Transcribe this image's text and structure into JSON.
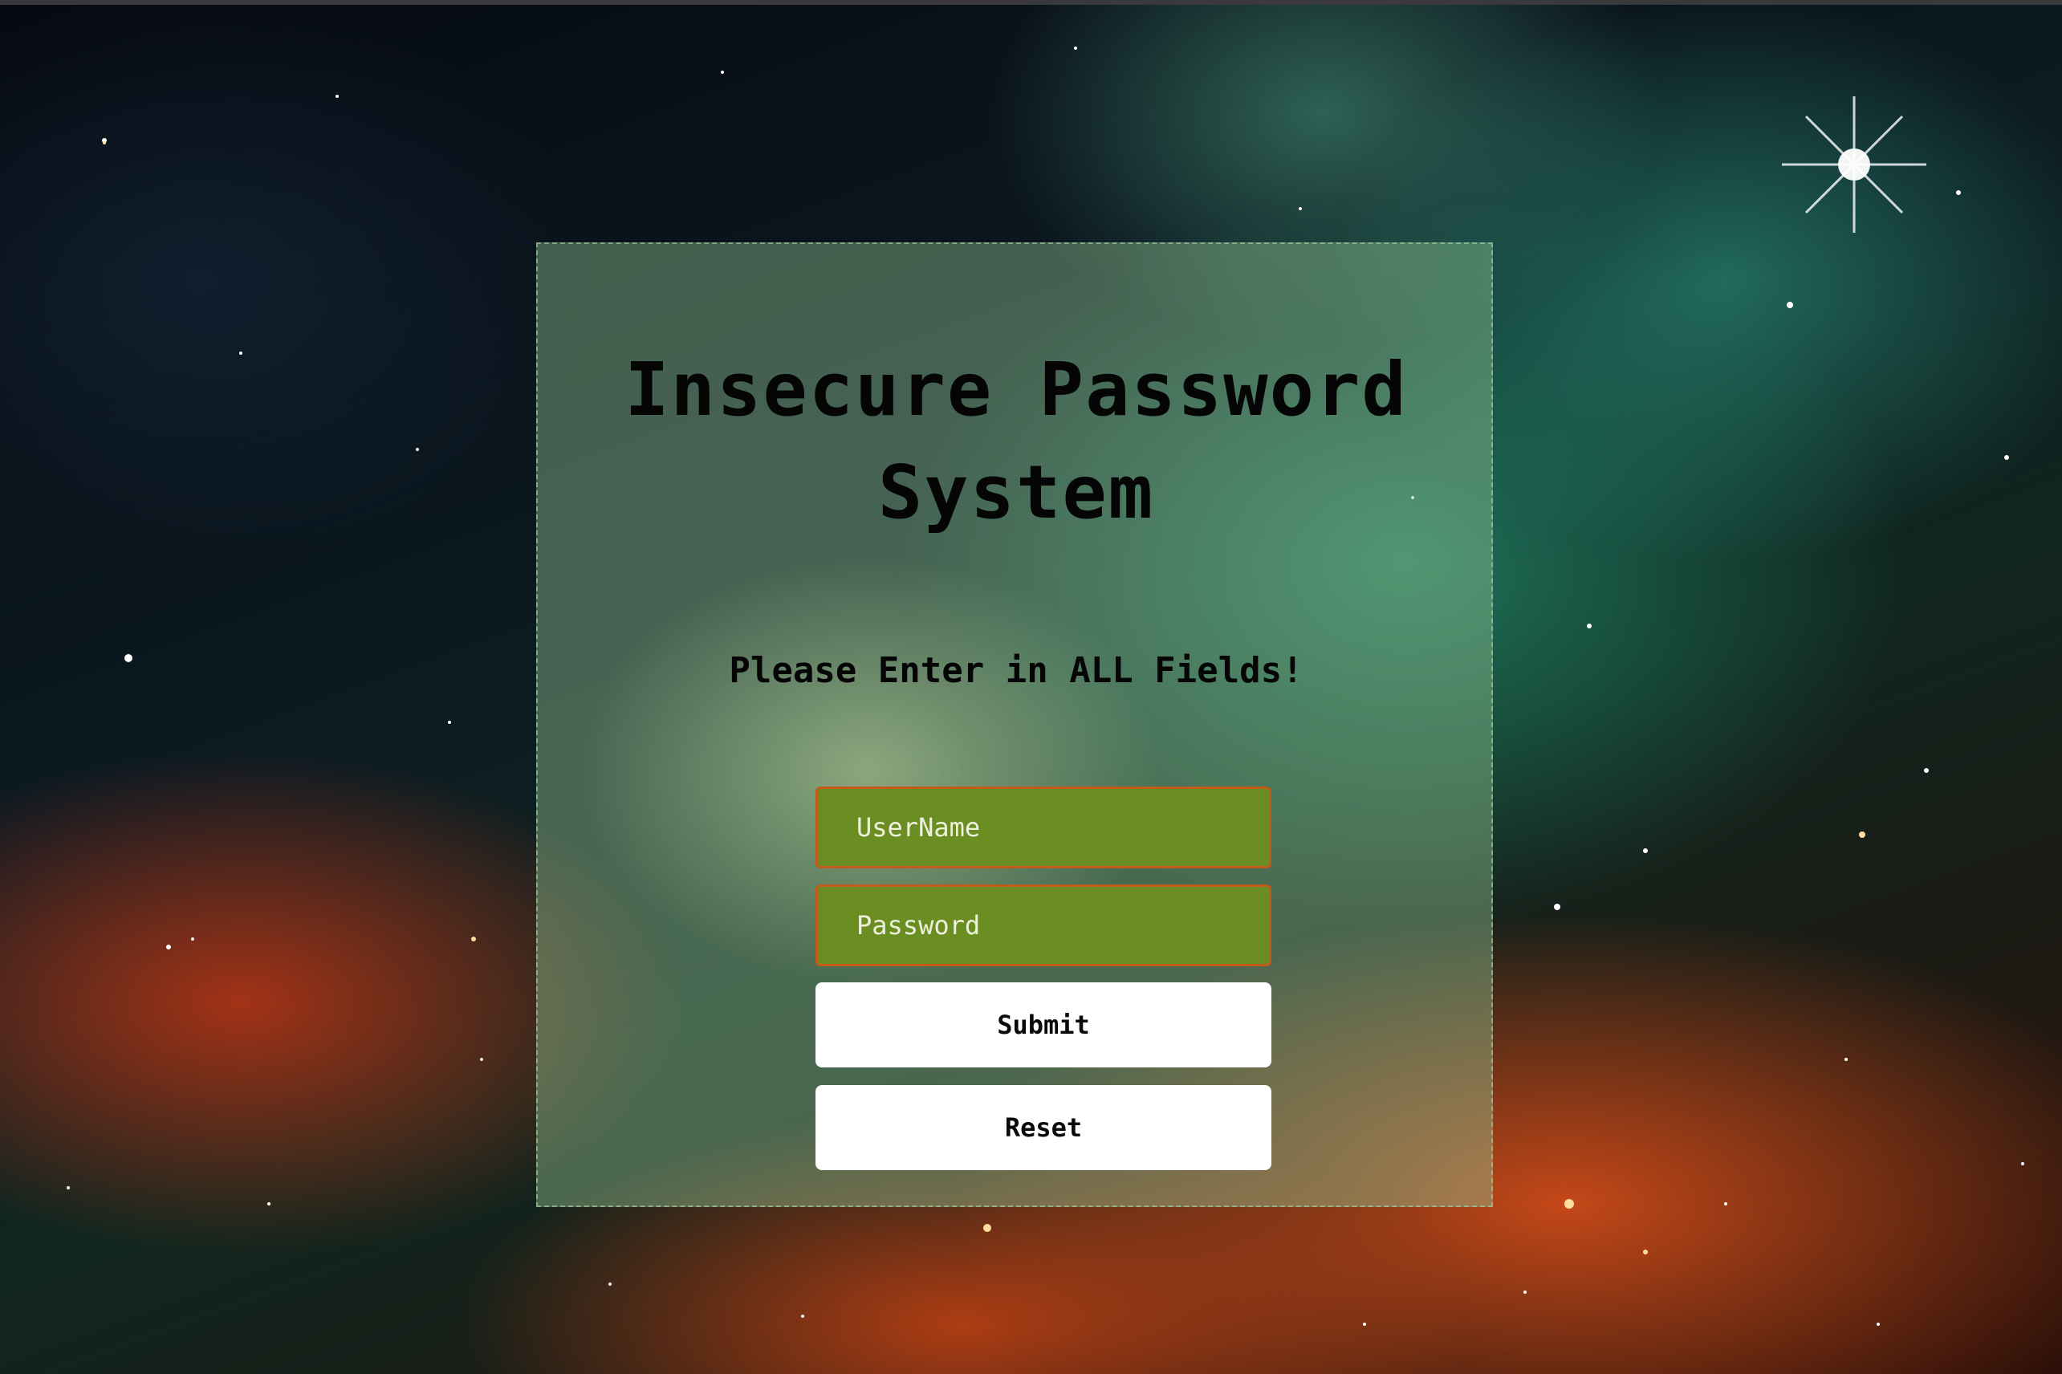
{
  "page": {
    "title": "Insecure Password System",
    "instruction": "Please Enter in ALL Fields!"
  },
  "form": {
    "username_placeholder": "UserName",
    "username_value": "",
    "password_placeholder": "Password",
    "password_value": "",
    "submit_label": "Submit",
    "reset_label": "Reset"
  },
  "colors": {
    "field_background": "#6b8e23",
    "field_border": "#c25a1c",
    "button_background": "#ffffff",
    "panel_tint": "rgba(150,200,150,0.42)"
  }
}
